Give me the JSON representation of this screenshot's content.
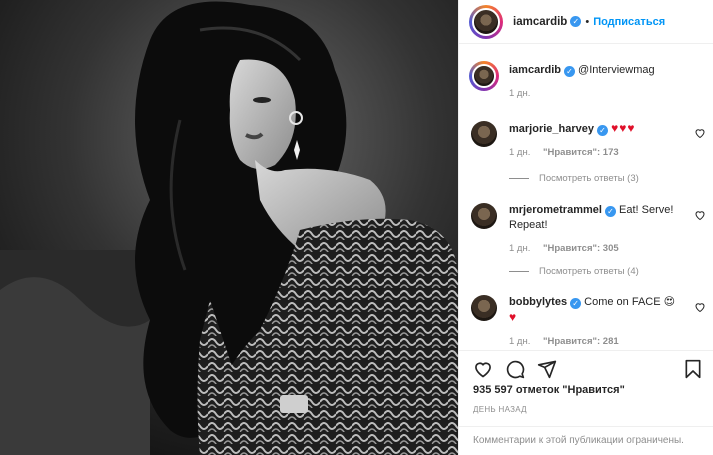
{
  "post": {
    "author": "iamcardib",
    "follow_label": "Подписаться",
    "separator": "•"
  },
  "caption": {
    "author": "iamcardib",
    "text": "@Interviewmag",
    "time": "1 дн."
  },
  "comments": [
    {
      "user": "marjorie_harvey",
      "text": "♥♥♥",
      "time": "1 дн.",
      "likes": "\"Нравится\": 173",
      "replies": "Посмотреть ответы (3)"
    },
    {
      "user": "mrjerometrammel",
      "text": "Eat! Serve! Repeat!",
      "time": "1 дн.",
      "likes": "\"Нравится\": 305",
      "replies": "Посмотреть ответы (4)"
    },
    {
      "user": "bobbylytes",
      "text": "Come on FACE 😍",
      "text_heart": "♥",
      "time": "1 дн.",
      "likes": "\"Нравится\": 281"
    }
  ],
  "footer": {
    "like_count": "935 597 отметок \"Нравится\"",
    "timestamp": "ДЕНЬ НАЗАД",
    "comments_disabled": "Комментарии к этой публикации ограничены."
  },
  "icons": {
    "like": "heart-icon",
    "comment": "comment-icon",
    "share": "share-icon",
    "save": "bookmark-icon",
    "verified": "verified-badge-icon"
  },
  "colors": {
    "link_blue": "#0095f6",
    "verified_blue": "#3897f0",
    "heart_red": "#e0102a",
    "muted": "#8e8e8e"
  }
}
